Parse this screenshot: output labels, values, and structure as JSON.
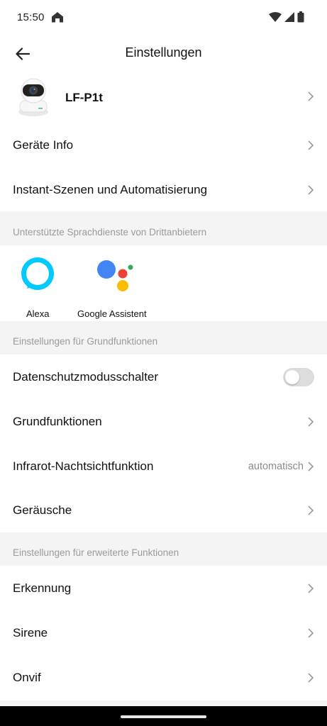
{
  "status": {
    "time": "15:50"
  },
  "header": {
    "title": "Einstellungen"
  },
  "device": {
    "name": "LF-P1t"
  },
  "rows_top": [
    {
      "label": "Geräte Info"
    },
    {
      "label": "Instant-Szenen und Automatisierung"
    }
  ],
  "sections": {
    "voice": "Unterstützte Sprachdienste von Drittanbietern",
    "basic": "Einstellungen für Grundfunktionen",
    "advanced": "Einstellungen für erweiterte Funktionen"
  },
  "assistants": [
    {
      "label": "Alexa",
      "color": "#00caff"
    },
    {
      "label": "Google Assistent"
    }
  ],
  "basic_rows": [
    {
      "label": "Datenschutzmodusschalter",
      "toggle": false
    },
    {
      "label": "Grundfunktionen"
    },
    {
      "label": "Infrarot-Nachtsichtfunktion",
      "value": "automatisch"
    },
    {
      "label": "Geräusche"
    }
  ],
  "advanced_rows": [
    {
      "label": "Erkennung"
    },
    {
      "label": "Sirene"
    },
    {
      "label": "Onvif"
    }
  ]
}
